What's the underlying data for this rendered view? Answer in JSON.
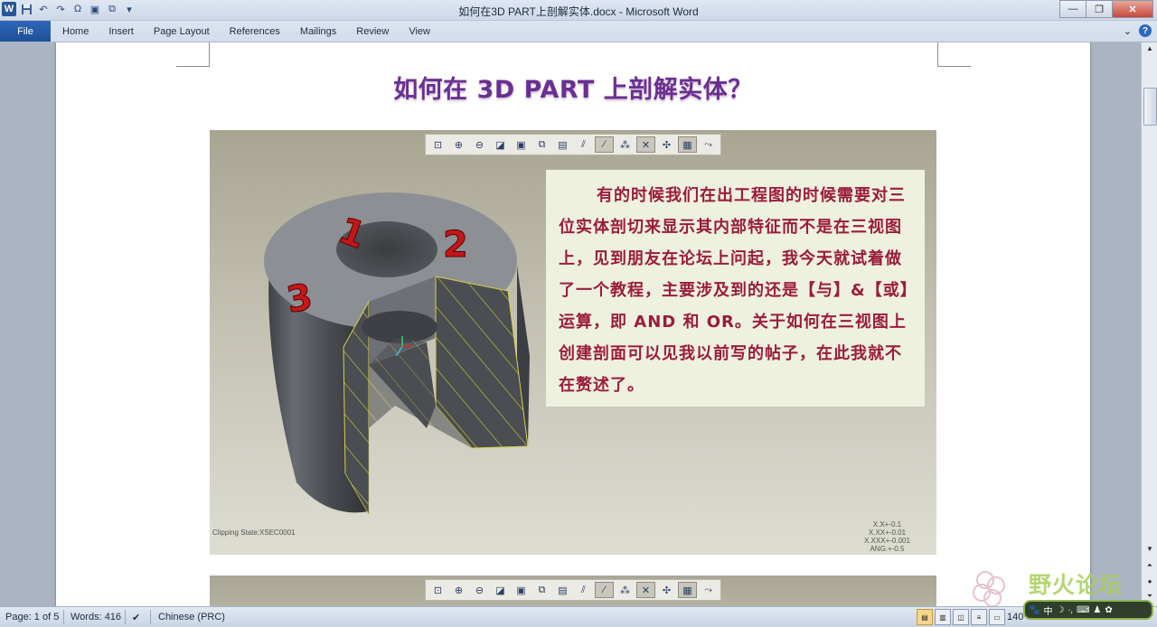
{
  "titlebar": {
    "title": "如何在3D PART上剖解实体.docx - Microsoft Word",
    "qat_icons": [
      "word-logo",
      "save-icon",
      "undo-icon",
      "redo-icon",
      "omega-symbol-icon",
      "insert-picture-icon",
      "layout-icon",
      "customize-qat-icon"
    ],
    "minimize": "—",
    "maximize": "❐",
    "close": "✕"
  },
  "ribbon": {
    "file_tab": "File",
    "tabs": [
      "Home",
      "Insert",
      "Page Layout",
      "References",
      "Mailings",
      "Review",
      "View"
    ],
    "expand": "⌄",
    "help": "?"
  },
  "document": {
    "title": "如何在 3D PART 上剖解实体？",
    "screenshot": {
      "toolbar_icons": [
        "refit-icon",
        "zoom-in-icon",
        "zoom-out-icon",
        "repaint-icon",
        "shaded-display-icon",
        "saved-views-icon",
        "view-manager-icon",
        "datum-planes-icon",
        "datum-axes-icon",
        "datum-points-icon",
        "coordinate-systems-icon",
        "spin-center-icon",
        "annotations-icon",
        "ref-orientation-icon"
      ],
      "callout_text": "有的时候我们在出工程图的时候需要对三位实体剖切来显示其内部特征而不是在三视图上，见到朋友在论坛上问起，我今天就试着做了一个教程，主要涉及到的还是【与】&【或】运算，即 AND 和 OR。关于如何在三视图上创建剖面可以见我以前写的帖子，在此我就不在赘述了。",
      "labels": [
        "1",
        "2",
        "3"
      ],
      "clipping_state": "Clipping State:XSEC0001",
      "tolerances": [
        "X.X+-0.1",
        "X.XX+-0.01",
        "X.XXX+-0.001",
        "ANG.+-0.5"
      ]
    }
  },
  "status": {
    "page": "Page: 1 of 5",
    "words": "Words: 416",
    "language": "Chinese (PRC)",
    "zoom": "140"
  },
  "watermark": {
    "text": "野火论坛"
  },
  "ime": {
    "mode": "中"
  },
  "colors": {
    "title": "#6b2f91",
    "callout_text": "#9b1c3c",
    "file_tab": "#2a5fae"
  }
}
